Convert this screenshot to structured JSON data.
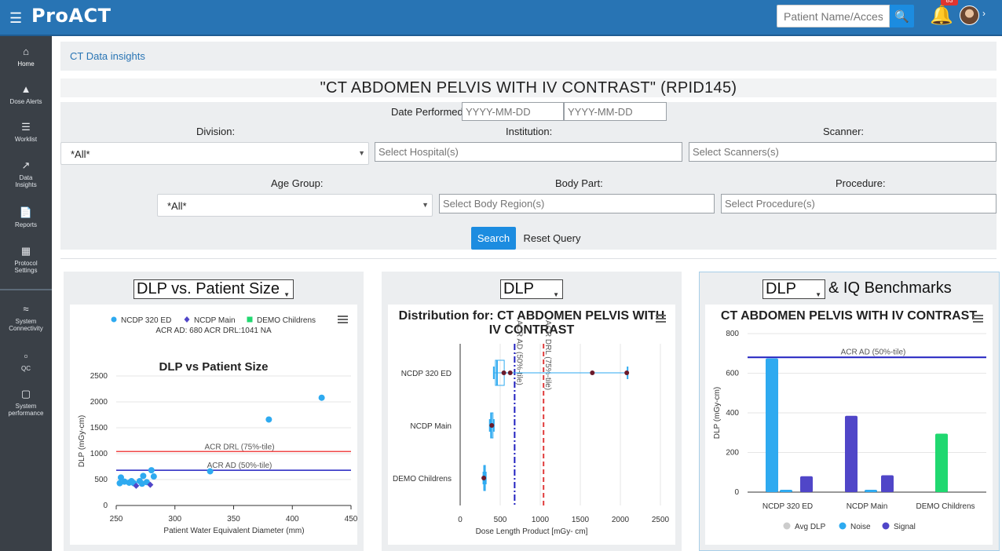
{
  "header": {
    "menu_icon": "hamburger-icon",
    "logo_text": "ProACT",
    "search_placeholder": "Patient Name/Accessio",
    "search_icon": "search-icon",
    "bell_icon": "bell-icon",
    "notifications_count": "83",
    "accent": "#2874b4"
  },
  "sidebar": {
    "items": [
      {
        "label": "Home",
        "icon": "home-icon"
      },
      {
        "label": "Dose Alerts",
        "icon": "warning-icon"
      },
      {
        "label": "Worklist",
        "icon": "list-icon"
      },
      {
        "label": "Data\nInsights",
        "icon": "line-chart-icon"
      },
      {
        "label": "Reports",
        "icon": "pdf-icon"
      },
      {
        "label": "Protocol\nSettings",
        "icon": "protocol-icon"
      },
      {
        "label": "System\nConnectivity",
        "icon": "wifi-icon"
      },
      {
        "label": "QC",
        "icon": "clipboard-icon"
      },
      {
        "label": "System\nperformance",
        "icon": "area-chart-icon"
      }
    ]
  },
  "breadcrumb": "CT Data insights",
  "page_title": "\"CT ABDOMEN PELVIS WITH IV CONTRAST\" (RPID145)",
  "filters": {
    "date_label": "Date Performed:",
    "date_from_placeholder": "YYYY-MM-DD",
    "date_to_placeholder": "YYYY-MM-DD",
    "division_label": "Division:",
    "division_value": "*All*",
    "institution_label": "Institution:",
    "institution_placeholder": "Select Hospital(s)",
    "scanner_label": "Scanner:",
    "scanner_placeholder": "Select Scanners(s)",
    "age_label": "Age Group:",
    "age_value": "*All*",
    "body_label": "Body Part:",
    "body_placeholder": "Select Body Region(s)",
    "procedure_label": "Procedure:",
    "procedure_placeholder": "Select Procedure(s)",
    "search_button": "Search",
    "reset_button": "Reset Query"
  },
  "panels": [
    {
      "selector": "DLP vs. Patient Size",
      "menu_icon": "hamburger-menu-icon"
    },
    {
      "selector": "DLP",
      "menu_icon": "hamburger-menu-icon"
    },
    {
      "selector": "DLP",
      "suffix": "& IQ Benchmarks",
      "menu_icon": "hamburger-menu-icon"
    }
  ],
  "chart_data": [
    {
      "type": "scatter",
      "title": "DLP vs Patient Size",
      "legend": [
        {
          "name": "NCDP 320 ED",
          "color": "#2eaaf0",
          "marker": "circle"
        },
        {
          "name": "NCDP Main",
          "color": "#5046c8",
          "marker": "diamond"
        },
        {
          "name": "DEMO Childrens",
          "color": "#20d870",
          "marker": "square"
        }
      ],
      "legend_subtitle": "ACR AD: 680 ACR DRL:1041 NA",
      "xlabel": "Patient Water Equivalent Diameter (mm)",
      "ylabel": "DLP (mGy-cm)",
      "xlim": [
        250,
        450
      ],
      "ylim": [
        0,
        2500
      ],
      "xticks": [
        "250",
        "300",
        "350",
        "400",
        "450"
      ],
      "yticks": [
        "0",
        "500",
        "1000",
        "1500",
        "2000",
        "2500"
      ],
      "reference_lines": [
        {
          "label": "ACR DRL (75%-tile)",
          "y": 1041,
          "color": "#f04848"
        },
        {
          "label": "ACR AD (50%-tile)",
          "y": 680,
          "color": "#2020c0"
        }
      ],
      "series": [
        {
          "name": "NCDP 320 ED",
          "points": [
            [
              253,
              430
            ],
            [
              254,
              540
            ],
            [
              257,
              460
            ],
            [
              261,
              440
            ],
            [
              263,
              470
            ],
            [
              265,
              430
            ],
            [
              270,
              470
            ],
            [
              272,
              420
            ],
            [
              273,
              570
            ],
            [
              276,
              450
            ],
            [
              282,
              560
            ],
            [
              280,
              680
            ],
            [
              330,
              660
            ],
            [
              380,
              1660
            ],
            [
              425,
              2080
            ]
          ]
        },
        {
          "name": "NCDP Main",
          "points": [
            [
              267,
              380
            ],
            [
              279,
              400
            ]
          ]
        }
      ]
    },
    {
      "type": "box",
      "title": "Distribution for: CT ABDOMEN PELVIS WITH IV CONTRAST",
      "xlabel": "Dose Length Product [mGy- cm]",
      "xlim": [
        0,
        2500
      ],
      "xticks": [
        "0",
        "500",
        "1000",
        "1500",
        "2000",
        "2500"
      ],
      "categories": [
        "NCDP 320 ED",
        "NCDP Main",
        "DEMO Childrens"
      ],
      "reference_lines": [
        {
          "label": "ACR AD (50%-tile)",
          "x": 680,
          "color": "#2020c0"
        },
        {
          "label": "ACR DRL (75%-tile)",
          "x": 1041,
          "color": "#e03c3c"
        }
      ],
      "boxes": [
        {
          "name": "NCDP 320 ED",
          "min": 420,
          "q1": 440,
          "median": 460,
          "q3": 550,
          "max": 2090,
          "outliers": [
            545,
            625,
            1650,
            2080
          ]
        },
        {
          "name": "NCDP Main",
          "min": 370,
          "q1": 380,
          "median": 390,
          "q3": 410,
          "max": 420,
          "outliers": [
            395
          ]
        },
        {
          "name": "DEMO Childrens",
          "min": 290,
          "q1": 295,
          "median": 300,
          "q3": 310,
          "max": 320,
          "outliers": [
            295
          ]
        }
      ]
    },
    {
      "type": "bar",
      "title": "CT ABDOMEN PELVIS WITH IV CONTRAST",
      "ylabel": "DLP (mGy-cm)",
      "ylim": [
        0,
        800
      ],
      "yticks": [
        "0",
        "200",
        "400",
        "600",
        "800"
      ],
      "categories": [
        "NCDP 320 ED",
        "NCDP Main",
        "DEMO Childrens"
      ],
      "reference_lines": [
        {
          "label": "ACR AD (50%-tile)",
          "y": 680,
          "color": "#2020c0"
        }
      ],
      "legend": [
        {
          "name": "Avg DLP",
          "color": "#cccccc"
        },
        {
          "name": "Noise",
          "color": "#2eaaf0"
        },
        {
          "name": "Signal",
          "color": "#5046c8"
        }
      ],
      "bars": [
        {
          "category": "NCDP 320 ED",
          "values": [
            {
              "series": "Avg DLP",
              "value": 675,
              "color": "#2eaaf0"
            },
            {
              "series": "Noise",
              "value": 12,
              "color": "#2eaaf0"
            },
            {
              "series": "Signal",
              "value": 80,
              "color": "#5046c8"
            }
          ]
        },
        {
          "category": "NCDP Main",
          "values": [
            {
              "series": "Avg DLP",
              "value": 385,
              "color": "#5046c8"
            },
            {
              "series": "Noise",
              "value": 12,
              "color": "#2eaaf0"
            },
            {
              "series": "Signal",
              "value": 85,
              "color": "#5046c8"
            }
          ]
        },
        {
          "category": "DEMO Childrens",
          "values": [
            {
              "series": "Avg DLP",
              "value": 295,
              "color": "#20d870"
            }
          ]
        }
      ]
    }
  ]
}
